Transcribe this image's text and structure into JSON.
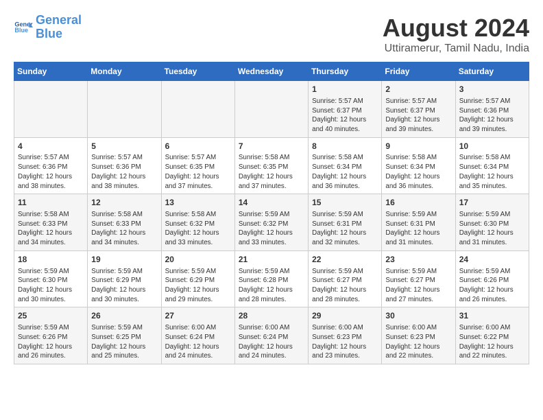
{
  "header": {
    "logo_line1": "General",
    "logo_line2": "Blue",
    "month_year": "August 2024",
    "location": "Uttiramerur, Tamil Nadu, India"
  },
  "weekdays": [
    "Sunday",
    "Monday",
    "Tuesday",
    "Wednesday",
    "Thursday",
    "Friday",
    "Saturday"
  ],
  "weeks": [
    [
      {
        "day": "",
        "info": ""
      },
      {
        "day": "",
        "info": ""
      },
      {
        "day": "",
        "info": ""
      },
      {
        "day": "",
        "info": ""
      },
      {
        "day": "1",
        "info": "Sunrise: 5:57 AM\nSunset: 6:37 PM\nDaylight: 12 hours\nand 40 minutes."
      },
      {
        "day": "2",
        "info": "Sunrise: 5:57 AM\nSunset: 6:37 PM\nDaylight: 12 hours\nand 39 minutes."
      },
      {
        "day": "3",
        "info": "Sunrise: 5:57 AM\nSunset: 6:36 PM\nDaylight: 12 hours\nand 39 minutes."
      }
    ],
    [
      {
        "day": "4",
        "info": "Sunrise: 5:57 AM\nSunset: 6:36 PM\nDaylight: 12 hours\nand 38 minutes."
      },
      {
        "day": "5",
        "info": "Sunrise: 5:57 AM\nSunset: 6:36 PM\nDaylight: 12 hours\nand 38 minutes."
      },
      {
        "day": "6",
        "info": "Sunrise: 5:57 AM\nSunset: 6:35 PM\nDaylight: 12 hours\nand 37 minutes."
      },
      {
        "day": "7",
        "info": "Sunrise: 5:58 AM\nSunset: 6:35 PM\nDaylight: 12 hours\nand 37 minutes."
      },
      {
        "day": "8",
        "info": "Sunrise: 5:58 AM\nSunset: 6:34 PM\nDaylight: 12 hours\nand 36 minutes."
      },
      {
        "day": "9",
        "info": "Sunrise: 5:58 AM\nSunset: 6:34 PM\nDaylight: 12 hours\nand 36 minutes."
      },
      {
        "day": "10",
        "info": "Sunrise: 5:58 AM\nSunset: 6:34 PM\nDaylight: 12 hours\nand 35 minutes."
      }
    ],
    [
      {
        "day": "11",
        "info": "Sunrise: 5:58 AM\nSunset: 6:33 PM\nDaylight: 12 hours\nand 34 minutes."
      },
      {
        "day": "12",
        "info": "Sunrise: 5:58 AM\nSunset: 6:33 PM\nDaylight: 12 hours\nand 34 minutes."
      },
      {
        "day": "13",
        "info": "Sunrise: 5:58 AM\nSunset: 6:32 PM\nDaylight: 12 hours\nand 33 minutes."
      },
      {
        "day": "14",
        "info": "Sunrise: 5:59 AM\nSunset: 6:32 PM\nDaylight: 12 hours\nand 33 minutes."
      },
      {
        "day": "15",
        "info": "Sunrise: 5:59 AM\nSunset: 6:31 PM\nDaylight: 12 hours\nand 32 minutes."
      },
      {
        "day": "16",
        "info": "Sunrise: 5:59 AM\nSunset: 6:31 PM\nDaylight: 12 hours\nand 31 minutes."
      },
      {
        "day": "17",
        "info": "Sunrise: 5:59 AM\nSunset: 6:30 PM\nDaylight: 12 hours\nand 31 minutes."
      }
    ],
    [
      {
        "day": "18",
        "info": "Sunrise: 5:59 AM\nSunset: 6:30 PM\nDaylight: 12 hours\nand 30 minutes."
      },
      {
        "day": "19",
        "info": "Sunrise: 5:59 AM\nSunset: 6:29 PM\nDaylight: 12 hours\nand 30 minutes."
      },
      {
        "day": "20",
        "info": "Sunrise: 5:59 AM\nSunset: 6:29 PM\nDaylight: 12 hours\nand 29 minutes."
      },
      {
        "day": "21",
        "info": "Sunrise: 5:59 AM\nSunset: 6:28 PM\nDaylight: 12 hours\nand 28 minutes."
      },
      {
        "day": "22",
        "info": "Sunrise: 5:59 AM\nSunset: 6:27 PM\nDaylight: 12 hours\nand 28 minutes."
      },
      {
        "day": "23",
        "info": "Sunrise: 5:59 AM\nSunset: 6:27 PM\nDaylight: 12 hours\nand 27 minutes."
      },
      {
        "day": "24",
        "info": "Sunrise: 5:59 AM\nSunset: 6:26 PM\nDaylight: 12 hours\nand 26 minutes."
      }
    ],
    [
      {
        "day": "25",
        "info": "Sunrise: 5:59 AM\nSunset: 6:26 PM\nDaylight: 12 hours\nand 26 minutes."
      },
      {
        "day": "26",
        "info": "Sunrise: 5:59 AM\nSunset: 6:25 PM\nDaylight: 12 hours\nand 25 minutes."
      },
      {
        "day": "27",
        "info": "Sunrise: 6:00 AM\nSunset: 6:24 PM\nDaylight: 12 hours\nand 24 minutes."
      },
      {
        "day": "28",
        "info": "Sunrise: 6:00 AM\nSunset: 6:24 PM\nDaylight: 12 hours\nand 24 minutes."
      },
      {
        "day": "29",
        "info": "Sunrise: 6:00 AM\nSunset: 6:23 PM\nDaylight: 12 hours\nand 23 minutes."
      },
      {
        "day": "30",
        "info": "Sunrise: 6:00 AM\nSunset: 6:23 PM\nDaylight: 12 hours\nand 22 minutes."
      },
      {
        "day": "31",
        "info": "Sunrise: 6:00 AM\nSunset: 6:22 PM\nDaylight: 12 hours\nand 22 minutes."
      }
    ]
  ]
}
